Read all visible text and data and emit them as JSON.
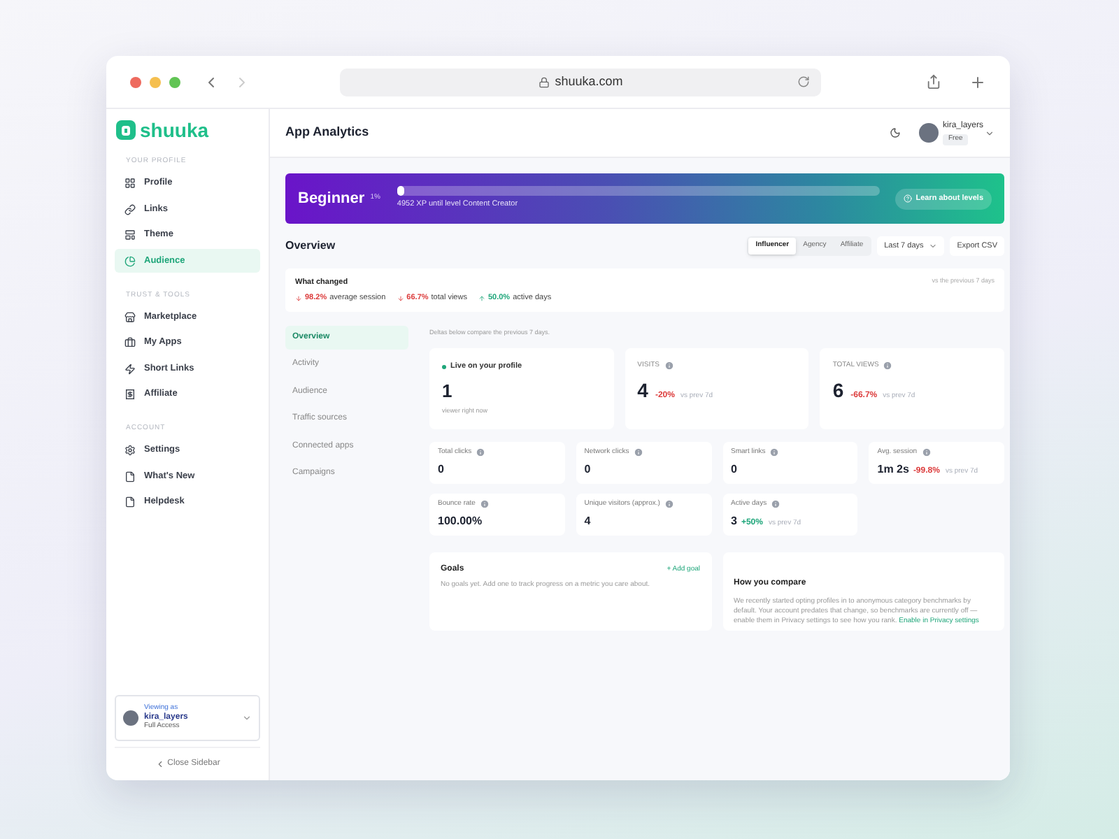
{
  "browser": {
    "url": "shuuka.com"
  },
  "sidebar": {
    "logo": "shuuka",
    "sections": [
      {
        "title": "YOUR PROFILE",
        "items": [
          {
            "label": "Profile",
            "selected": false
          },
          {
            "label": "Links",
            "selected": false
          },
          {
            "label": "Theme",
            "selected": false
          },
          {
            "label": "Audience",
            "selected": true
          }
        ]
      },
      {
        "title": "TRUST & TOOLS",
        "items": [
          {
            "label": "Marketplace",
            "selected": false
          },
          {
            "label": "My Apps",
            "selected": false
          },
          {
            "label": "Short Links",
            "selected": false
          },
          {
            "label": "Affiliate",
            "selected": false
          }
        ]
      },
      {
        "title": "ACCOUNT",
        "items": [
          {
            "label": "Settings",
            "selected": false
          },
          {
            "label": "What's New",
            "selected": false
          },
          {
            "label": "Helpdesk",
            "selected": false
          }
        ]
      }
    ],
    "viewer": {
      "caption": "Viewing as",
      "name": "kira_layers",
      "access": "Full Access"
    },
    "close": "Close Sidebar"
  },
  "header": {
    "title": "App Analytics",
    "user": {
      "name": "kira_layers",
      "plan": "Free"
    }
  },
  "banner": {
    "level_name": "Beginner",
    "percent": "1%",
    "level": 0.01,
    "caption": "4952 XP until level Content Creator",
    "button": "Learn about levels"
  },
  "overview": {
    "title": "Overview",
    "segments": [
      {
        "label": "Influencer",
        "selected": true
      },
      {
        "label": "Agency",
        "selected": false
      },
      {
        "label": "Affiliate",
        "selected": false
      }
    ],
    "period": "Last 7 days",
    "export": "Export CSV"
  },
  "what_changed": {
    "title": "What changed",
    "note": "vs the previous 7 days",
    "items": [
      {
        "kind": "down",
        "delta": "98.2%",
        "label": "average session"
      },
      {
        "kind": "down",
        "delta": "66.7%",
        "label": "total views"
      },
      {
        "kind": "up",
        "delta": "50.0%",
        "label": "active days"
      }
    ]
  },
  "subnav": [
    {
      "label": "Overview",
      "selected": true
    },
    {
      "label": "Activity",
      "selected": false
    },
    {
      "label": "Audience",
      "selected": false
    },
    {
      "label": "Traffic sources",
      "selected": false
    },
    {
      "label": "Connected apps",
      "selected": false
    },
    {
      "label": "Campaigns",
      "selected": false
    }
  ],
  "deltas_note": "Deltas below compare the previous 7 days.",
  "live": {
    "title": "Live on your profile",
    "value": "1",
    "caption": "viewer right now"
  },
  "big_stats": [
    {
      "label": "VISITS",
      "value": "4",
      "delta": "-20%",
      "kind": "down",
      "note": "vs prev 7d"
    },
    {
      "label": "TOTAL VIEWS",
      "value": "6",
      "delta": "-66.7%",
      "kind": "down",
      "note": "vs prev 7d"
    }
  ],
  "small_stats": [
    {
      "label": "Total clicks",
      "value": "0"
    },
    {
      "label": "Network clicks",
      "value": "0"
    },
    {
      "label": "Smart links",
      "value": "0"
    },
    {
      "label": "Avg. session",
      "value": "1m 2s",
      "delta": "-99.8%",
      "kind": "down",
      "note": "vs prev 7d"
    },
    {
      "label": "Bounce rate",
      "value": "100.00%"
    },
    {
      "label": "Unique visitors (approx.)",
      "value": "4"
    },
    {
      "label": "Active days",
      "value": "3",
      "delta": "+50%",
      "kind": "up",
      "note": "vs prev 7d"
    }
  ],
  "goals": {
    "title": "Goals",
    "action": "+ Add goal",
    "text": "No goals yet. Add one to track progress on a metric you care about."
  },
  "compare": {
    "title": "How you compare",
    "text": "We recently started opting profiles in to anonymous category benchmarks by default. Your account predates that change, so benchmarks are currently off — enable them in Privacy settings to see how you rank.",
    "link": "Enable in Privacy settings"
  }
}
